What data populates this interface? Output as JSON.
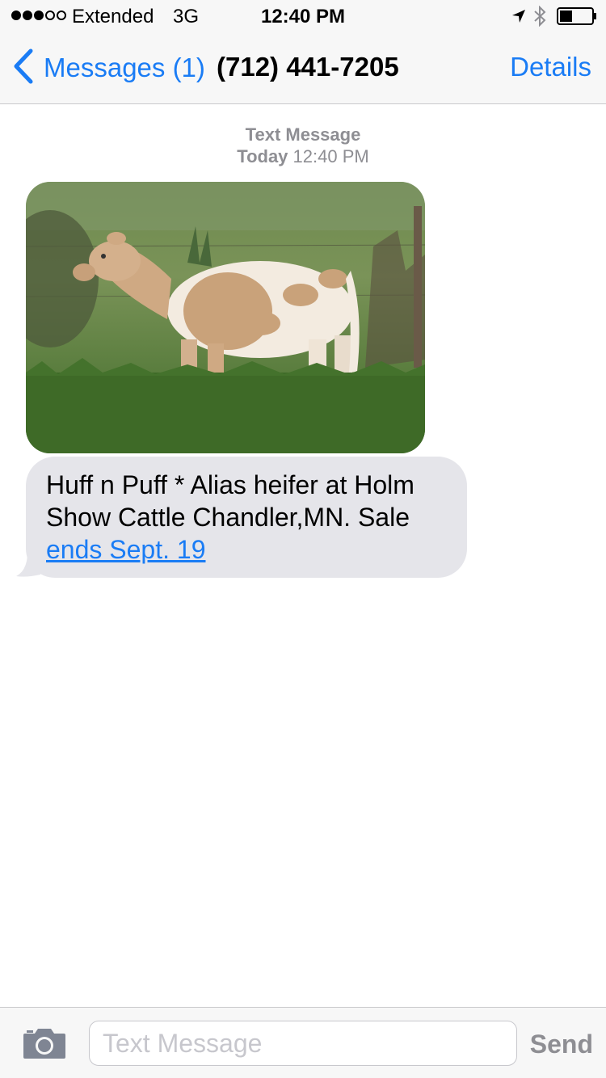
{
  "status_bar": {
    "signal_bars_filled": 3,
    "signal_bars_total": 5,
    "carrier": "Extended",
    "network": "3G",
    "time": "12:40 PM",
    "icons": [
      "location-arrow-icon",
      "bluetooth-icon",
      "battery-icon"
    ],
    "battery_level": 0.4
  },
  "nav": {
    "back_label": "Messages (1)",
    "title": "(712) 441-7205",
    "details_label": "Details"
  },
  "thread": {
    "type_label": "Text Message",
    "day": "Today",
    "time": "12:40 PM"
  },
  "messages": [
    {
      "kind": "photo",
      "direction": "incoming"
    },
    {
      "kind": "text",
      "direction": "incoming",
      "text_before_link": "Huff n Puff * Alias heifer at Holm Show Cattle Chandler,MN. Sale ",
      "link_text": "ends Sept. 19"
    }
  ],
  "input_bar": {
    "placeholder": "Text Message",
    "send_label": "Send",
    "camera_icon": "camera-icon"
  },
  "colors": {
    "accent": "#1a7cf5",
    "incoming_bubble": "#e5e5ea",
    "bar_background": "#f7f7f7",
    "muted_text": "#8e8e93"
  }
}
